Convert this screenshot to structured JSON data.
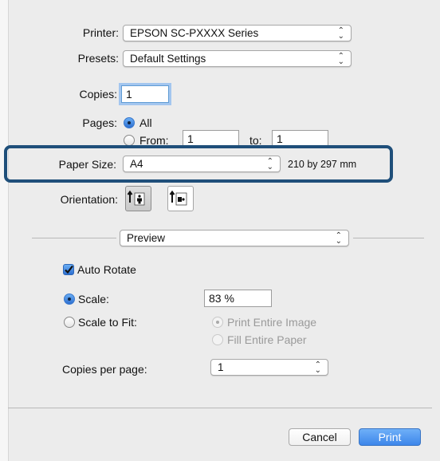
{
  "printer": {
    "label": "Printer:",
    "value": "EPSON SC-PXXXX Series"
  },
  "presets": {
    "label": "Presets:",
    "value": "Default Settings"
  },
  "copies": {
    "label": "Copies:",
    "value": "1"
  },
  "pages": {
    "label": "Pages:",
    "all_label": "All",
    "from_label": "From:",
    "from_value": "1",
    "to_label": "to:",
    "to_value": "1",
    "selected": "all"
  },
  "paper_size": {
    "label": "Paper Size:",
    "value": "A4",
    "dimensions": "210 by 297 mm"
  },
  "orientation": {
    "label": "Orientation:",
    "selected": "portrait"
  },
  "section_popup": {
    "value": "Preview"
  },
  "preview": {
    "auto_rotate_label": "Auto Rotate",
    "auto_rotate_checked": true,
    "scale_label": "Scale:",
    "scale_value": "83 %",
    "scale_to_fit_label": "Scale to Fit:",
    "print_entire_image_label": "Print Entire Image",
    "fill_entire_paper_label": "Fill Entire Paper",
    "copies_per_page_label": "Copies per page:",
    "copies_per_page_value": "1"
  },
  "buttons": {
    "cancel": "Cancel",
    "print": "Print"
  },
  "colors": {
    "highlight_border": "#1f4f7a",
    "focus_ring": "#a3c6ef",
    "default_button": "#3d86ea"
  },
  "icons": {
    "popup_arrows": "up-down-chevrons-icon",
    "portrait": "portrait-orientation-icon",
    "landscape": "landscape-orientation-icon",
    "checkmark": "checkmark-icon"
  }
}
